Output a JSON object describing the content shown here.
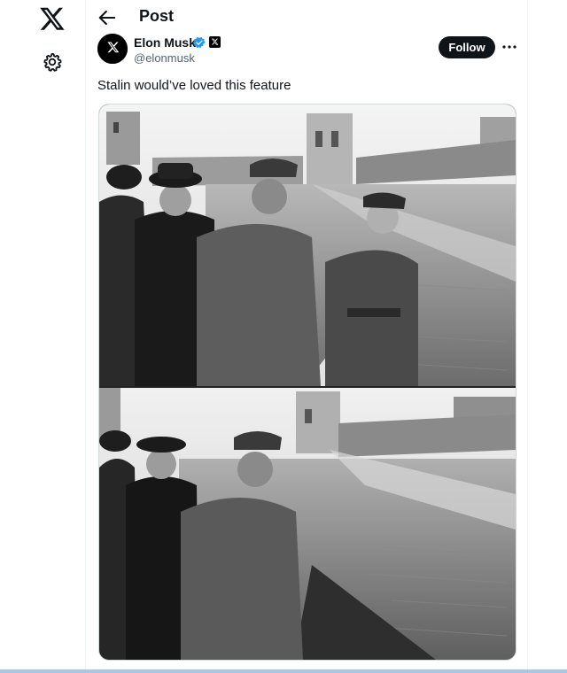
{
  "nav": {
    "logo_icon": "x-logo-icon",
    "settings_icon": "gear-icon"
  },
  "header": {
    "title": "Post",
    "back_icon": "arrow-left-icon"
  },
  "post": {
    "author": {
      "name": "Elon Musk",
      "handle": "@elonmusk",
      "verified": true
    },
    "follow_label": "Follow",
    "more_icon": "ellipsis-icon",
    "text": "Stalin would’ve loved this feature",
    "media": [
      {
        "description_icon": "photo-original"
      },
      {
        "description_icon": "photo-edited"
      }
    ]
  },
  "colors": {
    "text": "#0f1419",
    "secondary": "#536471",
    "verified": "#1d9bf0",
    "border": "#eff3f4"
  }
}
